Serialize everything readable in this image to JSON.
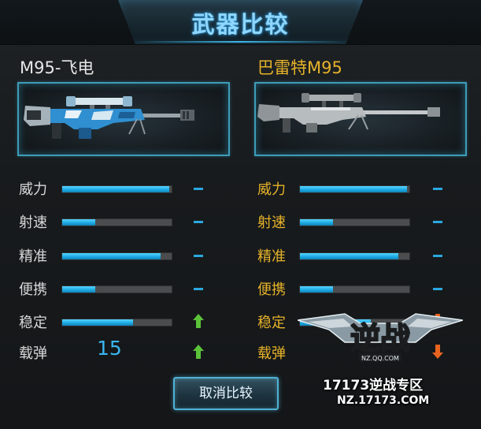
{
  "window": {
    "title": "武器比较"
  },
  "left_weapon": {
    "name": "M95-飞电"
  },
  "right_weapon": {
    "name": "巴雷特M95"
  },
  "stats": [
    {
      "label": "威力",
      "left_fill": 0.98,
      "right_fill": 0.98,
      "left_indicator": "dash",
      "right_indicator": "dash"
    },
    {
      "label": "射速",
      "left_fill": 0.3,
      "right_fill": 0.3,
      "left_indicator": "dash",
      "right_indicator": "dash"
    },
    {
      "label": "精准",
      "left_fill": 0.9,
      "right_fill": 0.9,
      "left_indicator": "dash",
      "right_indicator": "dash"
    },
    {
      "label": "便携",
      "left_fill": 0.3,
      "right_fill": 0.3,
      "left_indicator": "dash",
      "right_indicator": "dash"
    },
    {
      "label": "稳定",
      "left_fill": 0.65,
      "right_fill": 0.65,
      "left_indicator": "up-arrow",
      "right_indicator": "down-arrow"
    },
    {
      "label": "载弹",
      "left_value": "15",
      "left_indicator": "up-arrow",
      "right_indicator": "down-arrow"
    }
  ],
  "buttons": {
    "cancel_compare": "取消比较"
  },
  "watermark": {
    "logo_text": "逆战",
    "logo_sub": "NZ.QQ.COM",
    "line1": "17173逆战专区",
    "line2": "NZ.17173.COM"
  },
  "colors": {
    "accent_blue": "#39b6ee",
    "gold": "#e6b22a",
    "up_green": "#5cc23a",
    "down_orange": "#e8641e"
  },
  "icons": {
    "left_weapon_image": "sniper-rifle-blue-icon",
    "right_weapon_image": "sniper-rifle-gray-icon",
    "up": "up-arrow-icon",
    "down": "down-arrow-icon",
    "equal": "dash-icon"
  }
}
